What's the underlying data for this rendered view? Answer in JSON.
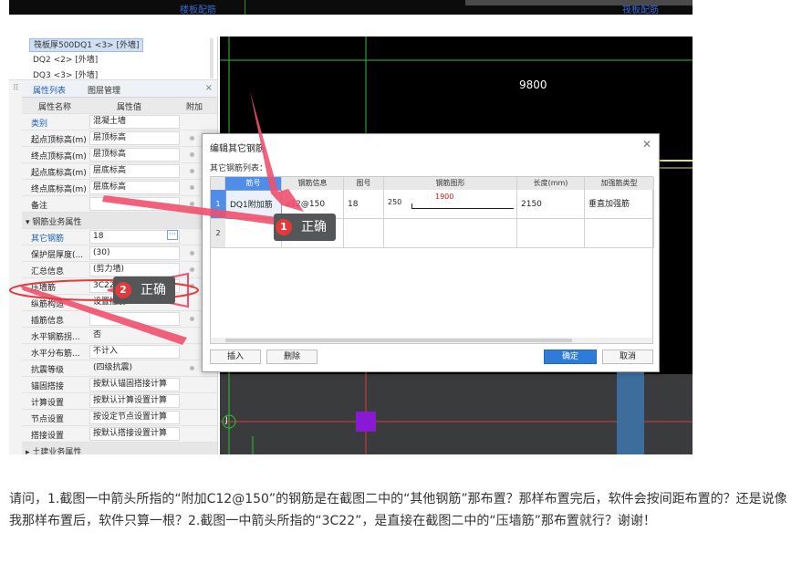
{
  "top_strip": {
    "label_left": "楼板配筋",
    "label_right": "筏板配筋"
  },
  "component_list": {
    "items": [
      "筏板厚500DQ1 <3> [外墙]",
      "DQ2 <2> [外墙]",
      "DQ3 <3> [外墙]"
    ]
  },
  "panel_tabs": {
    "properties": "属性列表",
    "layers": "图层管理",
    "close": "×"
  },
  "prop_table": {
    "col_name": "属性名称",
    "col_value": "属性值",
    "col_extra": "附加",
    "rows": [
      {
        "name": "类别",
        "value": "混凝土墙"
      },
      {
        "name": "起点顶标高(m)",
        "value": "层顶标高"
      },
      {
        "name": "终点顶标高(m)",
        "value": "层顶标高"
      },
      {
        "name": "起点底标高(m)",
        "value": "层底标高"
      },
      {
        "name": "终点底标高(m)",
        "value": "层底标高"
      },
      {
        "name": "备注",
        "value": ""
      }
    ],
    "group_label": "▾ 钢筋业务属性",
    "rebar_rows": [
      {
        "name": "其它钢筋",
        "value": "18"
      },
      {
        "name": "保护层厚度(...",
        "value": "(30)"
      },
      {
        "name": "汇总信息",
        "value": "(剪力墙)"
      },
      {
        "name": "压墙筋",
        "value": "3C22"
      },
      {
        "name": "纵筋构造",
        "value": "设置插筋"
      },
      {
        "name": "插筋信息",
        "value": ""
      },
      {
        "name": "水平钢筋拐...",
        "value": "否"
      },
      {
        "name": "水平分布筋...",
        "value": "不计入"
      },
      {
        "name": "抗震等级",
        "value": "(四级抗震)"
      },
      {
        "name": "锚固搭接",
        "value": "按默认锚固搭接计算"
      },
      {
        "name": "计算设置",
        "value": "按默认计算设置计算"
      },
      {
        "name": "节点设置",
        "value": "按设定节点设置计算"
      },
      {
        "name": "搭接设置",
        "value": "按默认搭接设置计算"
      }
    ],
    "footer": "▸ 土建业务属性"
  },
  "cad": {
    "dimension": "9800",
    "axis_label": "J"
  },
  "dialog": {
    "title": "编辑其它钢筋",
    "subtitle": "其它钢筋列表：",
    "columns": [
      "筋号",
      "钢筋信息",
      "图号",
      "钢筋图形",
      "长度(mm)",
      "加强筋类型"
    ],
    "rows": [
      {
        "index": "1",
        "bar_no": "DQ1附加筋",
        "info": "⌀12@150",
        "figure_no": "18",
        "shape_lead": "250",
        "shape_value": "1900",
        "length": "2150",
        "type": "垂直加强筋"
      },
      {
        "index": "2",
        "bar_no": "",
        "info": "",
        "figure_no": "",
        "shape_lead": "",
        "shape_value": "",
        "length": "",
        "type": ""
      }
    ],
    "buttons": {
      "insert": "插入",
      "delete": "删除",
      "ok": "确定",
      "cancel": "取消"
    }
  },
  "annotations": [
    {
      "badge": "1",
      "text": "正确"
    },
    {
      "badge": "2",
      "text": "正确"
    }
  ],
  "question": "请问，1.截图一中箭头所指的“附加C12@150”的钢筋是在截图二中的“其他钢筋”那布置？那样布置完后，软件会按间距布置的？还是说像我那样布置后，软件只算一根？2.截图一中箭头所指的“3C22”，是直接在截图二中的“压墙筋”那布置就行？谢谢！",
  "colors": {
    "accent": "#2f7bd8",
    "arrow": "#f0506e",
    "badge": "#e03a3a",
    "cad_bg": "#000000"
  }
}
